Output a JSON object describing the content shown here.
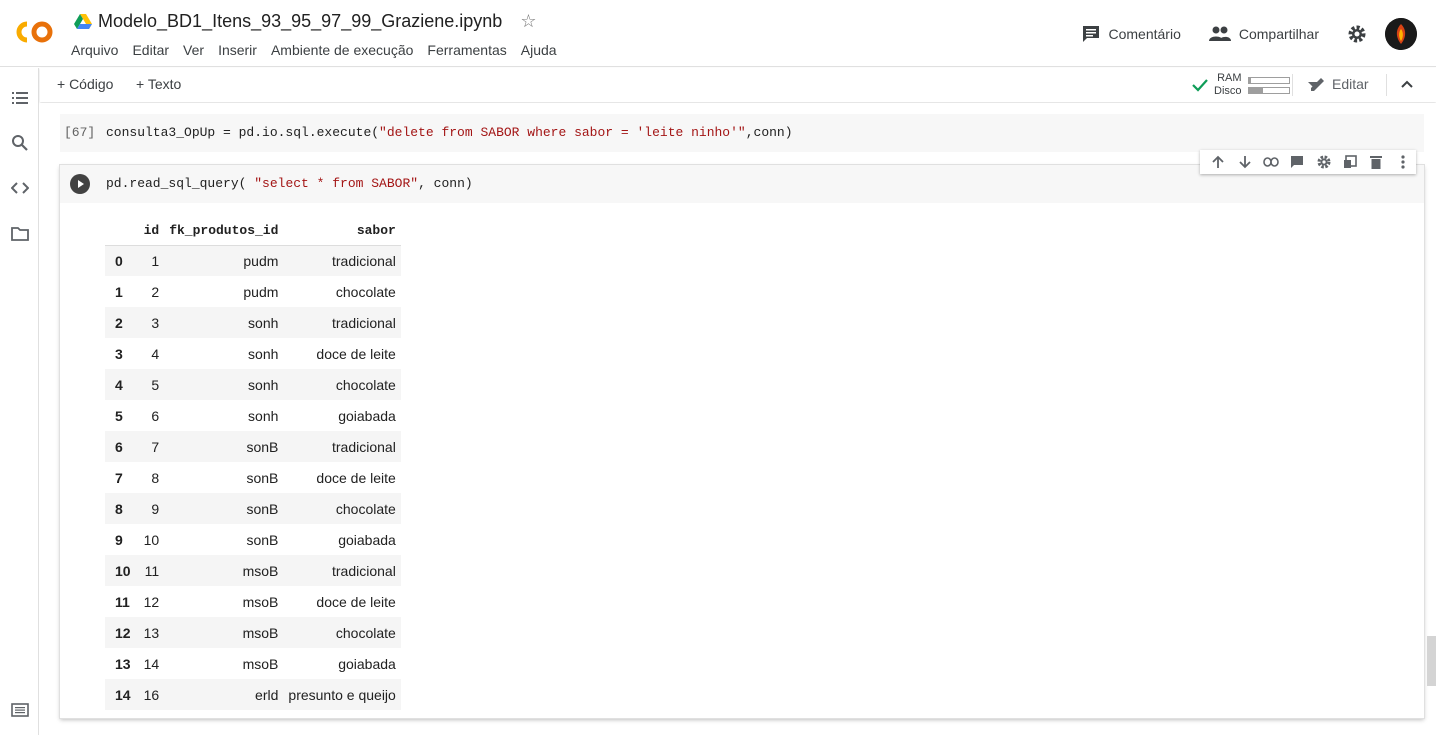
{
  "header": {
    "notebook_title": "Modelo_BD1_Itens_93_95_97_99_Graziene.ipynb",
    "menu": [
      "Arquivo",
      "Editar",
      "Ver",
      "Inserir",
      "Ambiente de execução",
      "Ferramentas",
      "Ajuda"
    ],
    "comment_label": "Comentário",
    "share_label": "Compartilhar"
  },
  "toolbar": {
    "add_code_label": "+ Código",
    "add_text_label": "+ Texto",
    "ram_label": "RAM",
    "disk_label": "Disco",
    "ram_usage": 0.05,
    "disk_usage": 0.35,
    "edit_label": "Editar"
  },
  "cells": [
    {
      "exec_count": "[67]",
      "code_prefix": "consulta3_OpUp = pd.io.sql.execute(",
      "code_string": "\"delete from SABOR where sabor = 'leite ninho'\"",
      "code_suffix": ",conn)"
    },
    {
      "code_prefix": "pd.read_sql_query( ",
      "code_string": "\"select * from SABOR\"",
      "code_suffix": ", conn)"
    }
  ],
  "output_table": {
    "columns": [
      "",
      "id",
      "fk_produtos_id",
      "sabor"
    ],
    "rows": [
      [
        "0",
        "1",
        "pudm",
        "tradicional"
      ],
      [
        "1",
        "2",
        "pudm",
        "chocolate"
      ],
      [
        "2",
        "3",
        "sonh",
        "tradicional"
      ],
      [
        "3",
        "4",
        "sonh",
        "doce de leite"
      ],
      [
        "4",
        "5",
        "sonh",
        "chocolate"
      ],
      [
        "5",
        "6",
        "sonh",
        "goiabada"
      ],
      [
        "6",
        "7",
        "sonB",
        "tradicional"
      ],
      [
        "7",
        "8",
        "sonB",
        "doce de leite"
      ],
      [
        "8",
        "9",
        "sonB",
        "chocolate"
      ],
      [
        "9",
        "10",
        "sonB",
        "goiabada"
      ],
      [
        "10",
        "11",
        "msoB",
        "tradicional"
      ],
      [
        "11",
        "12",
        "msoB",
        "doce de leite"
      ],
      [
        "12",
        "13",
        "msoB",
        "chocolate"
      ],
      [
        "13",
        "14",
        "msoB",
        "goiabada"
      ],
      [
        "14",
        "16",
        "erld",
        "presunto e queijo"
      ]
    ]
  },
  "colors": {
    "accent": "#F9AB00",
    "logo_orange": "#E8710A",
    "check": "#0F9D58"
  }
}
